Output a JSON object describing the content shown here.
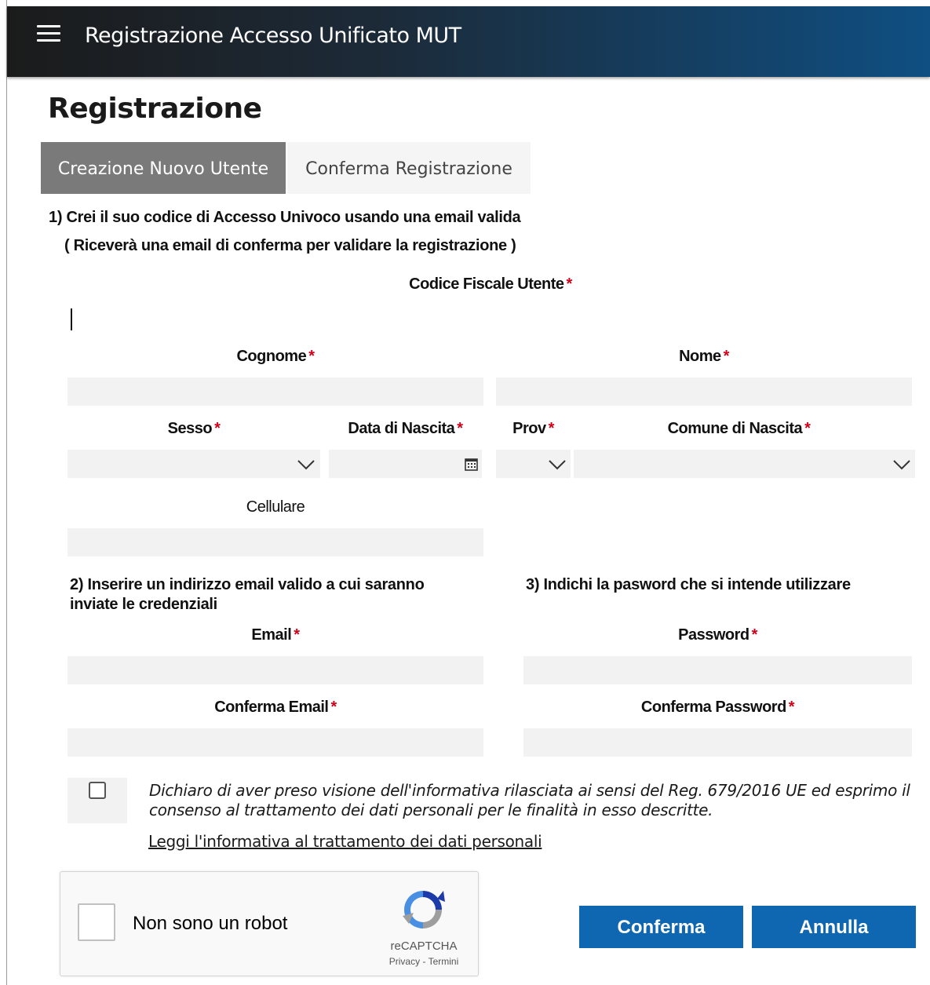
{
  "header": {
    "title": "Registrazione Accesso Unificato MUT",
    "menu_icon": "hamburger-menu-icon"
  },
  "page": {
    "title": "Registrazione"
  },
  "tabs": [
    {
      "label": "Creazione Nuovo Utente",
      "active": true
    },
    {
      "label": "Conferma Registrazione",
      "active": false
    }
  ],
  "steps": {
    "step1_line1": "1) Crei il suo codice di Accesso Univoco usando una email valida",
    "step1_line2": "( Riceverà una email di conferma per validare la registrazione )",
    "step2_line1": "2) Inserire un indirizzo email valido a cui saranno",
    "step2_line2": "inviate le credenziali",
    "step3": "3) Indichi la pasword che si intende utilizzare"
  },
  "fields": {
    "codice_fiscale": {
      "label": "Codice Fiscale Utente",
      "value": ""
    },
    "cognome": {
      "label": "Cognome",
      "value": ""
    },
    "nome": {
      "label": "Nome",
      "value": ""
    },
    "sesso": {
      "label": "Sesso",
      "value": ""
    },
    "data_nascita": {
      "label": "Data di Nascita",
      "value": ""
    },
    "prov": {
      "label": "Prov",
      "value": ""
    },
    "comune_nascita": {
      "label": "Comune di Nascita",
      "value": ""
    },
    "cellulare": {
      "label": "Cellulare",
      "value": ""
    },
    "email": {
      "label": "Email",
      "value": ""
    },
    "conferma_email": {
      "label": "Conferma Email",
      "value": ""
    },
    "password": {
      "label": "Password",
      "value": ""
    },
    "conferma_password": {
      "label": "Conferma Password",
      "value": ""
    }
  },
  "required_mark": "*",
  "consent": {
    "text_line1": "Dichiaro di aver preso visione dell'informativa rilasciata ai sensi del Reg. 679/2016 UE ed esprimo il",
    "text_line2": "consenso al trattamento dei dati personali per le finalità in esso descritte.",
    "link": "Leggi l'informativa al trattamento dei dati personali",
    "checked": false
  },
  "recaptcha": {
    "label": "Non sono un robot",
    "brand": "reCAPTCHA",
    "privacy": "Privacy",
    "separator": " - ",
    "terms": "Termini"
  },
  "buttons": {
    "confirm": "Conferma",
    "cancel": "Annulla"
  },
  "colors": {
    "header_dark": "#1b1b1b",
    "header_blue": "#0f4f82",
    "tab_active": "#7a7a7a",
    "button": "#0f67b1",
    "required": "#d0021b",
    "field_bg": "#f2f2f2"
  }
}
